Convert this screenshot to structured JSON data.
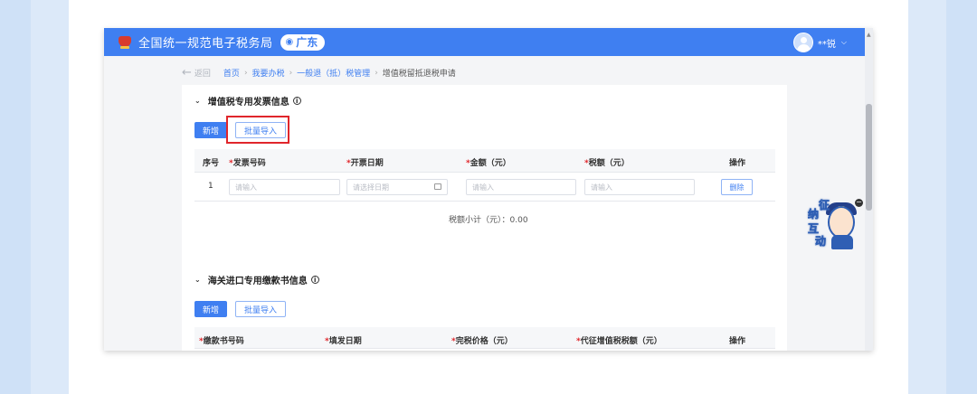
{
  "header": {
    "app_title": "全国统一规范电子税务局",
    "region": "广东",
    "user_name": "**锐"
  },
  "breadcrumb": {
    "back_label": "返回",
    "items": [
      "首页",
      "我要办税",
      "一般退（抵）税管理"
    ],
    "current": "增值税留抵退税申请"
  },
  "section1": {
    "title": "增值税专用发票信息",
    "add_label": "新增",
    "import_label": "批量导入",
    "columns": [
      "序号",
      "发票号码",
      "开票日期",
      "金额（元）",
      "税额（元）",
      "操作"
    ],
    "row": {
      "index": "1",
      "invoice_placeholder": "请输入",
      "date_placeholder": "请选择日期",
      "amount_placeholder": "请输入",
      "tax_placeholder": "请输入",
      "delete_label": "删除"
    },
    "subtotal": "税额小计（元）：0.00"
  },
  "section2": {
    "title": "海关进口专用缴款书信息",
    "add_label": "新增",
    "import_label": "批量导入",
    "columns": [
      "缴款书号码",
      "填发日期",
      "完税价格（元）",
      "代征增值税税额（元）",
      "操作"
    ]
  },
  "assistant": {
    "chars": [
      "征",
      "纳",
      "互",
      "动"
    ]
  },
  "colors": {
    "brand_blue": "#3f7ff1",
    "highlight_red": "#e0262b"
  }
}
